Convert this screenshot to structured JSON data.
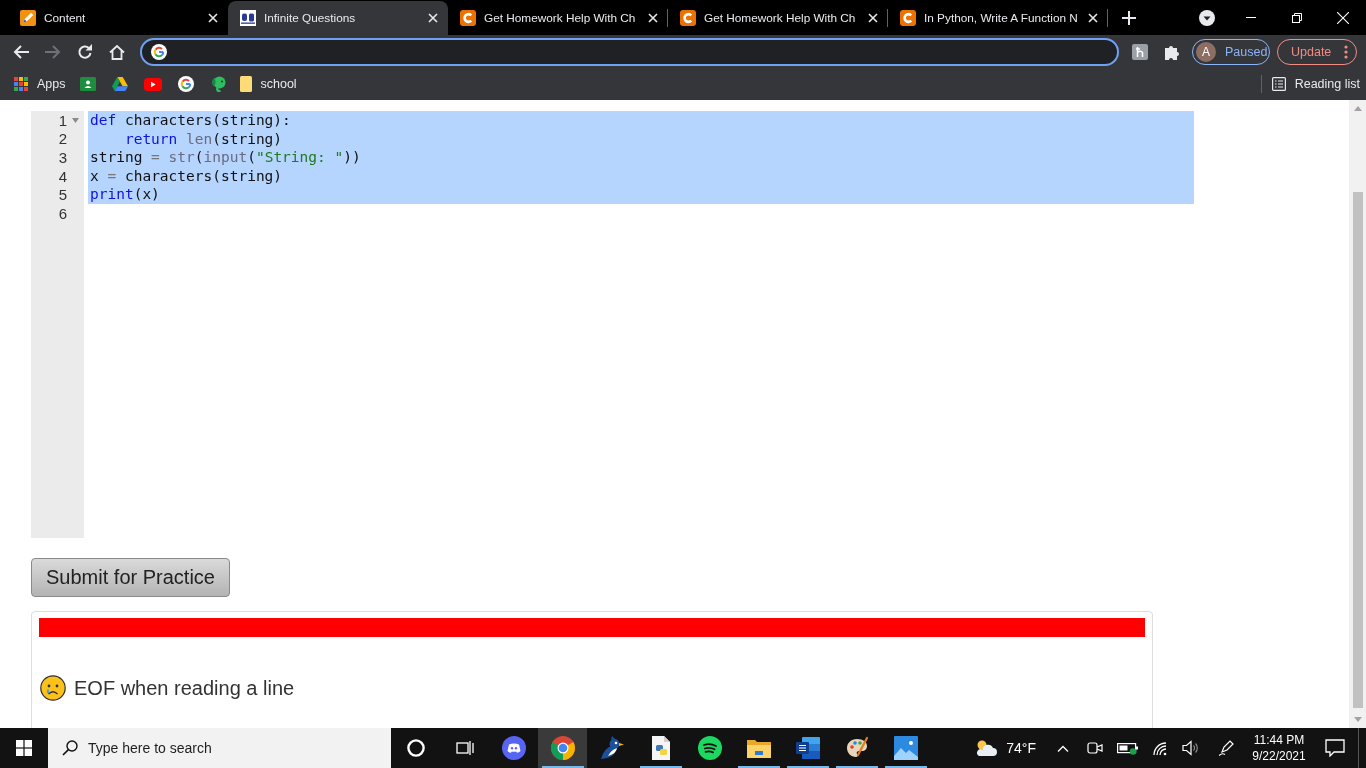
{
  "tabs": [
    {
      "kind": "pencil",
      "title": "Content",
      "selected": false
    },
    {
      "kind": "crest",
      "title": "Infinite Questions",
      "selected": true
    },
    {
      "kind": "c-logo",
      "title": "Get Homework Help With Ch",
      "selected": false
    },
    {
      "kind": "c-logo",
      "title": "Get Homework Help With Ch",
      "selected": false
    },
    {
      "kind": "c-logo",
      "title": "In Python, Write A Function N",
      "selected": false
    }
  ],
  "toolbar": {
    "forward_disabled": true,
    "omnibox_focused": true,
    "profile": {
      "initial": "A",
      "label": "Paused"
    },
    "update_button": "Update"
  },
  "bookmarks": {
    "items": [
      {
        "kind": "grid",
        "label": "Apps"
      },
      {
        "kind": "person-tile"
      },
      {
        "kind": "triangle"
      },
      {
        "kind": "play"
      },
      {
        "kind": "g-logo"
      },
      {
        "kind": "elephant"
      },
      {
        "kind": "folder",
        "label": "school"
      }
    ],
    "reading_list": "Reading list"
  },
  "editor": {
    "lines": [
      {
        "number": "1",
        "foldable": true,
        "selected": true,
        "tokens": [
          {
            "kind": "keyword",
            "text": "def"
          },
          {
            "kind": "plain",
            "text": " characters(string):"
          }
        ]
      },
      {
        "number": "2",
        "foldable": false,
        "selected": true,
        "tokens": [
          {
            "kind": "keyword",
            "text": "    return "
          },
          {
            "kind": "builtin",
            "text": "len"
          },
          {
            "kind": "plain",
            "text": "(string)"
          }
        ]
      },
      {
        "number": "3",
        "foldable": false,
        "selected": true,
        "tokens": [
          {
            "kind": "plain",
            "text": "string"
          },
          {
            "kind": "operator",
            "text": " = "
          },
          {
            "kind": "builtin",
            "text": "str"
          },
          {
            "kind": "plain",
            "text": "("
          },
          {
            "kind": "builtin",
            "text": "input"
          },
          {
            "kind": "plain",
            "text": "("
          },
          {
            "kind": "string",
            "text": "\"String: \""
          },
          {
            "kind": "plain",
            "text": "))"
          }
        ]
      },
      {
        "number": "4",
        "foldable": false,
        "selected": true,
        "tokens": [
          {
            "kind": "plain",
            "text": "x"
          },
          {
            "kind": "operator",
            "text": " = "
          },
          {
            "kind": "plain",
            "text": "characters(string)"
          }
        ]
      },
      {
        "number": "5",
        "foldable": false,
        "selected": true,
        "tokens": [
          {
            "kind": "keyword",
            "text": "print"
          },
          {
            "kind": "plain",
            "text": "(x)"
          }
        ]
      },
      {
        "number": "6",
        "foldable": false,
        "selected": false
      }
    ]
  },
  "submit_button": "Submit for Practice",
  "result": {
    "progress": {
      "level": 1
    },
    "message": "EOF when reading a line"
  },
  "taskbar": {
    "search_placeholder": "Type here to search",
    "apps": [
      {
        "kind": "ring",
        "selected": false,
        "running": false
      },
      {
        "kind": "task-view",
        "selected": false,
        "running": false
      },
      {
        "kind": "controller",
        "selected": false,
        "running": false
      },
      {
        "kind": "tricolor",
        "selected": true,
        "running": true
      },
      {
        "kind": "bird",
        "selected": false,
        "running": false
      },
      {
        "kind": "script",
        "selected": false,
        "running": true
      },
      {
        "kind": "waves",
        "selected": false,
        "running": false
      },
      {
        "kind": "folder",
        "selected": false,
        "running": true
      },
      {
        "kind": "document",
        "selected": false,
        "running": true
      },
      {
        "kind": "palette",
        "selected": false,
        "running": true
      },
      {
        "kind": "landscape",
        "selected": false,
        "running": true
      }
    ],
    "weather": "74°F",
    "clock": {
      "time": "11:44 PM",
      "date": "9/22/2021"
    }
  }
}
